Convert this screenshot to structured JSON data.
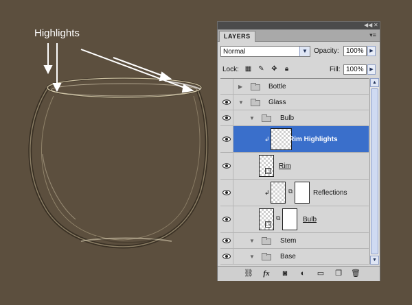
{
  "annotation": {
    "label": "Highlights"
  },
  "panel": {
    "tab_label": "LAYERS",
    "collapse_icon": "double-left-arrow",
    "close_icon": "close-x",
    "menu_icon": "panel-menu",
    "blend_mode": "Normal",
    "opacity_label": "Opacity:",
    "opacity_value": "100%",
    "lock_label": "Lock:",
    "fill_label": "Fill:",
    "fill_value": "100%"
  },
  "layers": [
    {
      "name": "Bottle",
      "kind": "group",
      "visible": false,
      "expanded": false,
      "depth": 0
    },
    {
      "name": "Glass",
      "kind": "group",
      "visible": true,
      "expanded": true,
      "depth": 0
    },
    {
      "name": "Bulb",
      "kind": "group",
      "visible": true,
      "expanded": true,
      "depth": 1
    },
    {
      "name": "Rim Highlights",
      "kind": "layer",
      "visible": true,
      "selected": true,
      "clipped": true
    },
    {
      "name": "Rim",
      "kind": "smart-object",
      "visible": true
    },
    {
      "name": "Reflections",
      "kind": "layer-with-mask",
      "visible": true,
      "clipped": true
    },
    {
      "name": "Bulb",
      "kind": "smart-object-with-mask",
      "visible": true
    },
    {
      "name": "Stem",
      "kind": "group",
      "visible": true,
      "expanded": false,
      "depth": 1
    },
    {
      "name": "Base",
      "kind": "group",
      "visible": true,
      "expanded": false,
      "depth": 1
    }
  ],
  "toolbar_icons": [
    "link-icon",
    "fx-icon",
    "add-mask-icon",
    "adjustment-layer-icon",
    "new-group-icon",
    "new-layer-icon",
    "trash-icon"
  ],
  "toolbar_labels": {
    "fx": "fx"
  },
  "colors": {
    "background": "#5c4f3e",
    "selection": "#3a6fcb",
    "panel": "#d6d6d6"
  }
}
